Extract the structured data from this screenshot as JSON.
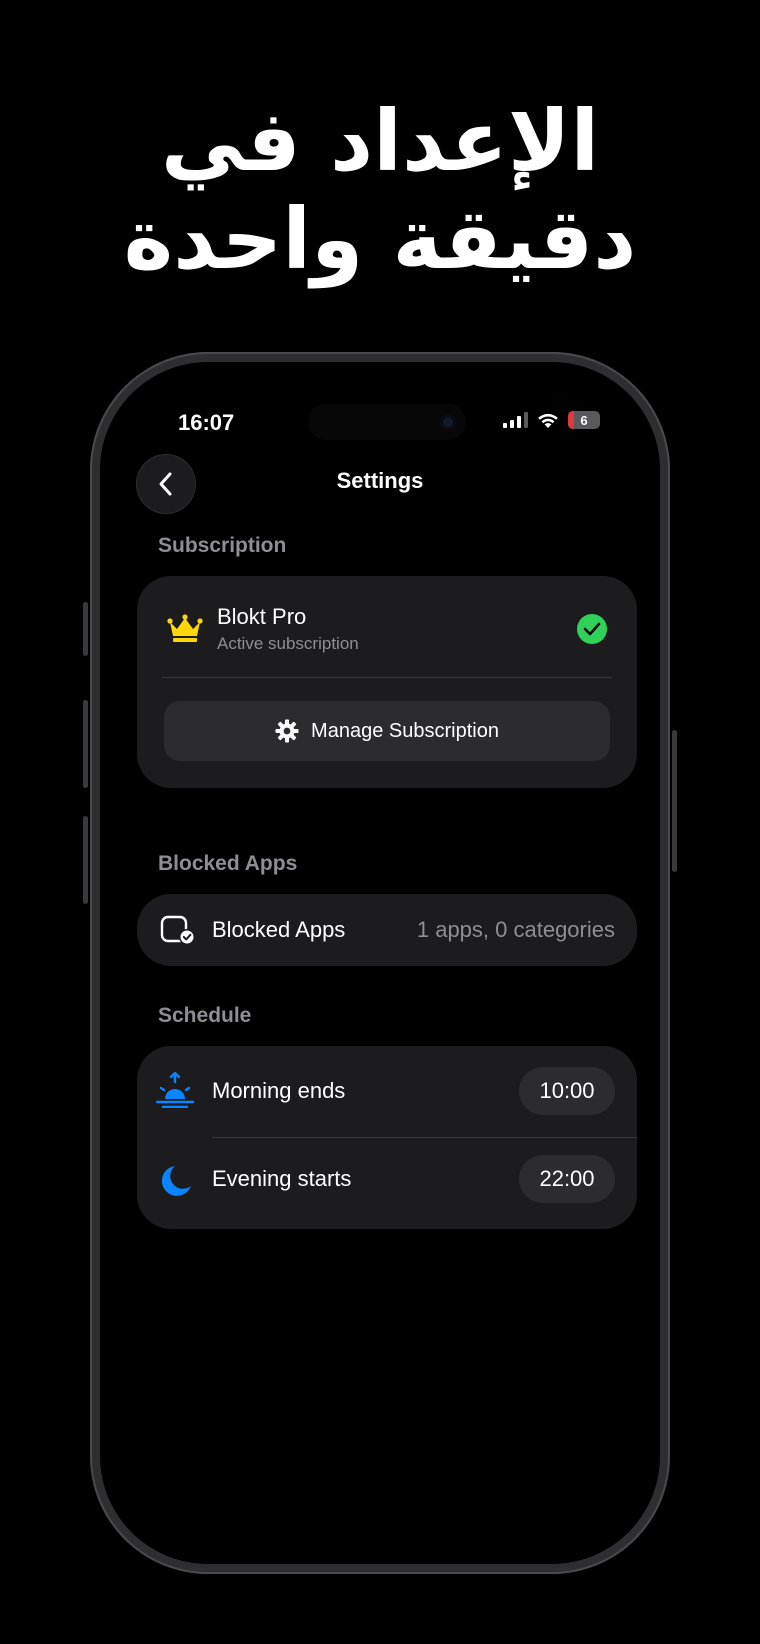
{
  "headline": {
    "line1": "الإعداد في",
    "line2": "دقيقة واحدة"
  },
  "status_bar": {
    "time": "16:07",
    "battery_level": "6",
    "battery_color": "#e0383e"
  },
  "nav": {
    "title": "Settings",
    "back_icon": "chevron-left-icon"
  },
  "subscription": {
    "section_label": "Subscription",
    "plan_icon": "crown-icon",
    "plan_name": "Blokt Pro",
    "plan_status": "Active subscription",
    "status_icon": "checkmark-circle-icon",
    "manage_label": "Manage Subscription",
    "manage_icon": "gear-icon"
  },
  "blocked_apps": {
    "section_label": "Blocked Apps",
    "row_label": "Blocked Apps",
    "row_value": "1 apps, 0 categories",
    "row_icon": "app-check-icon"
  },
  "schedule": {
    "section_label": "Schedule",
    "items": [
      {
        "label": "Morning ends",
        "time": "10:00",
        "icon": "sunrise-icon"
      },
      {
        "label": "Evening starts",
        "time": "22:00",
        "icon": "moon-icon"
      }
    ]
  },
  "colors": {
    "accent_blue": "#0a84ff",
    "crown_gold": "#ffd60a",
    "check_green": "#30d158",
    "card_bg": "#1c1c1e",
    "secondary_text": "#8e8e93"
  }
}
